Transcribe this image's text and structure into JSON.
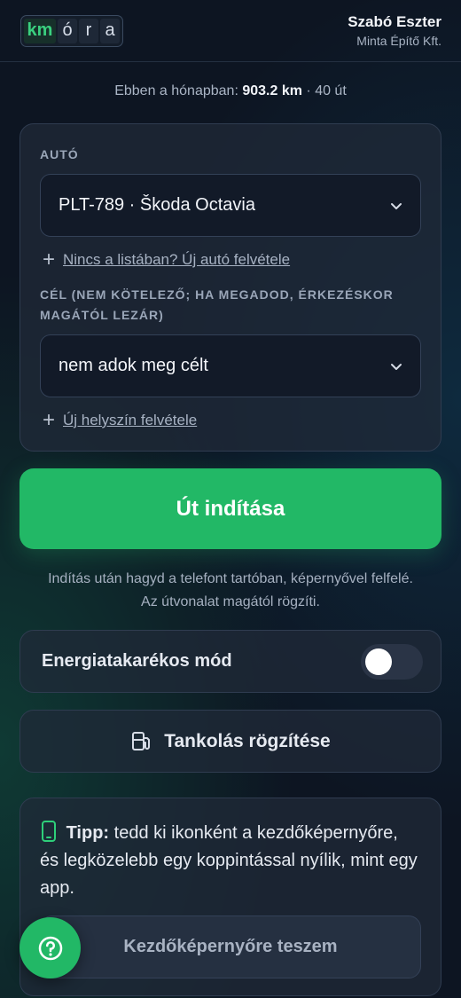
{
  "header": {
    "logo_letters": [
      "km",
      "ó",
      "r",
      "a"
    ],
    "user_name": "Szabó Eszter",
    "company": "Minta Építő Kft."
  },
  "stats": {
    "prefix": "Ebben a hónapban:",
    "distance": "903.2 km",
    "separator": "·",
    "trips": "40 út"
  },
  "form": {
    "car_label": "AUTÓ",
    "car_selected": "PLT-789 · Škoda Octavia",
    "add_car_link": "Nincs a listában? Új autó felvétele",
    "goal_label": "CÉL (NEM KÖTELEZŐ; HA MEGADOD, ÉRKEZÉSKOR MAGÁTÓL LEZÁR)",
    "goal_selected": "nem adok meg célt",
    "add_place_link": "Új helyszín felvétele"
  },
  "start_button": "Út indítása",
  "hint_line1": "Indítás után hagyd a telefont tartóban, képernyővel felfelé.",
  "hint_line2": "Az útvonalat magától rögzíti.",
  "energy_saver": {
    "label": "Energiatakarékos mód",
    "enabled": false
  },
  "fuel_button": "Tankolás rögzítése",
  "tip": {
    "title": "Tipp:",
    "text": "tedd ki ikonként a kezdőképernyőre, és legközelebb egy koppintással nyílik, mint egy app.",
    "button": "Kezdőképernyőre teszem"
  },
  "colors": {
    "accent": "#22b866",
    "background": "#0d1522",
    "card": "#202938"
  },
  "icons": [
    "chevron-down-icon",
    "plus-icon",
    "fuel-pump-icon",
    "phone-icon",
    "help-icon"
  ]
}
